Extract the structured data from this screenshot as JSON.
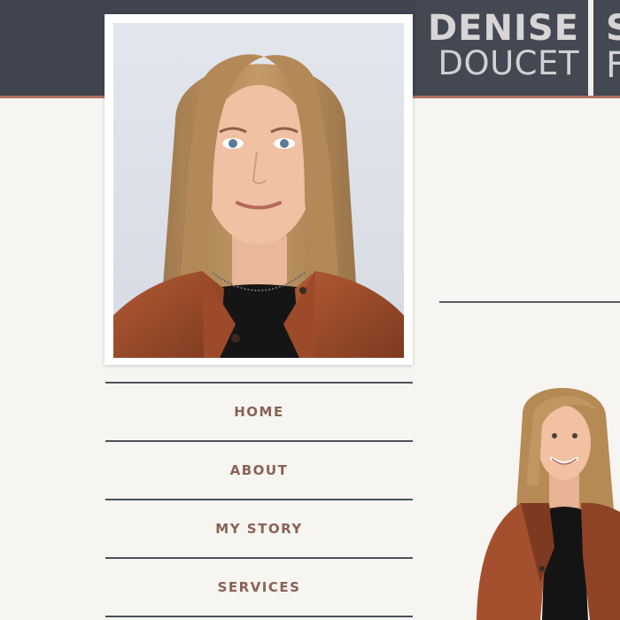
{
  "header": {
    "first_name": "DENISE",
    "last_name": "DOUCET",
    "next_block_line1": "S",
    "next_block_line2": "F"
  },
  "nav": {
    "items": [
      {
        "label": "HOME"
      },
      {
        "label": "ABOUT"
      },
      {
        "label": "MY STORY"
      },
      {
        "label": "SERVICES"
      }
    ]
  },
  "colors": {
    "header_bg": "#3f444e",
    "header_accent": "#b07164",
    "nav_text": "#8a6256",
    "page_bg": "#f7f5f1"
  }
}
